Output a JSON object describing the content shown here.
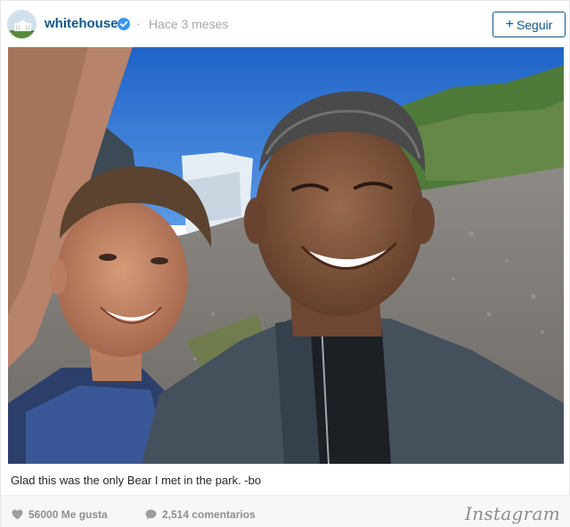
{
  "post": {
    "username": "whitehouse",
    "separator": "·",
    "timestamp": "Hace 3 meses",
    "follow_label": "Seguir",
    "follow_plus": "+",
    "caption": "Glad this was the only Bear I met in the park. -bo"
  },
  "stats": {
    "likes": "56000 Me gusta",
    "comments": "2,514 comentarios"
  },
  "brand": {
    "logo_text": "Instagram"
  },
  "icons": {
    "avatar": "white-house-avatar",
    "verified": "verified-badge-icon",
    "like": "heart-icon",
    "comment": "comment-bubble-icon"
  },
  "colors": {
    "username": "#125688",
    "follow_border": "#125688",
    "verified": "#3897f0",
    "muted": "#a5a7aa",
    "footer_bg": "#f7f7f7"
  }
}
